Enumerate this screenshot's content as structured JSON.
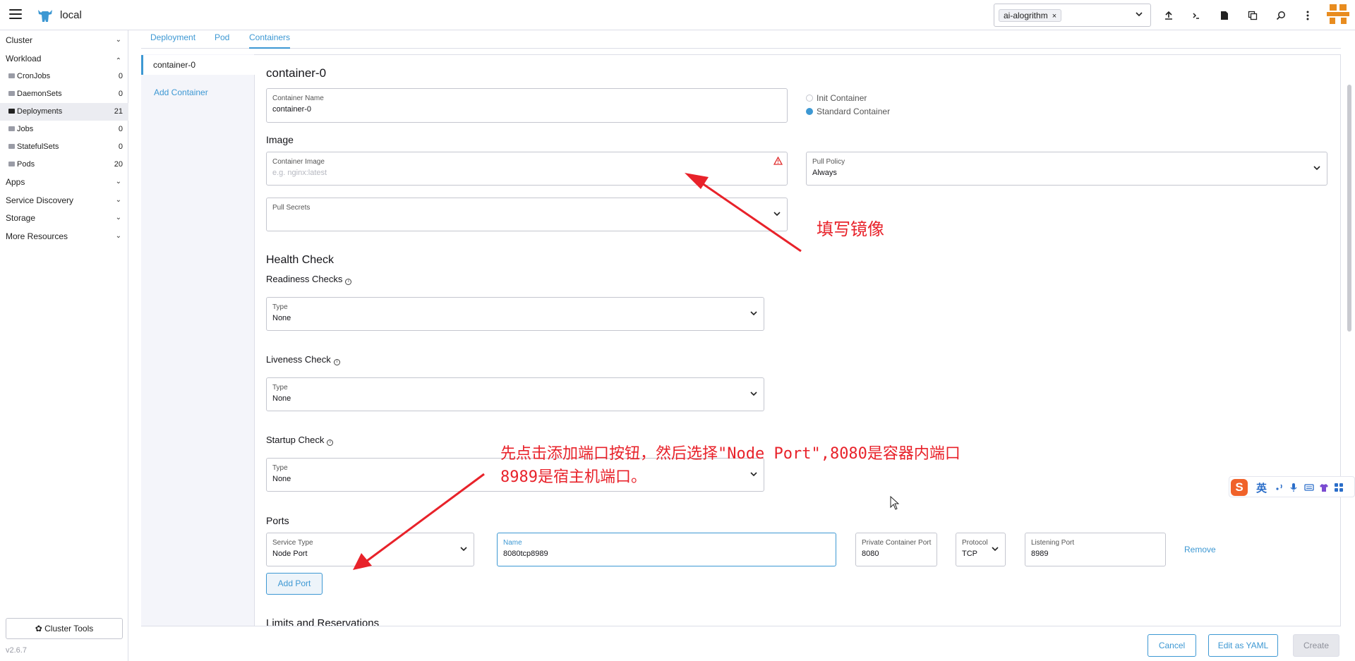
{
  "header": {
    "cluster_name": "local",
    "namespace_chip": "ai-alogrithm",
    "namespace_chip_close": "×"
  },
  "sidebar": {
    "groups": [
      {
        "label": "Cluster",
        "chevron": "⌄"
      },
      {
        "label": "Workload",
        "chevron": "⌃"
      },
      {
        "label": "Apps",
        "chevron": "⌄"
      },
      {
        "label": "Service Discovery",
        "chevron": "⌄"
      },
      {
        "label": "Storage",
        "chevron": "⌄"
      },
      {
        "label": "More Resources",
        "chevron": "⌄"
      }
    ],
    "items": [
      {
        "label": "CronJobs",
        "count": "0"
      },
      {
        "label": "DaemonSets",
        "count": "0"
      },
      {
        "label": "Deployments",
        "count": "21"
      },
      {
        "label": "Jobs",
        "count": "0"
      },
      {
        "label": "StatefulSets",
        "count": "0"
      },
      {
        "label": "Pods",
        "count": "20"
      }
    ],
    "cluster_tools": "✿ Cluster Tools",
    "version": "v2.6.7"
  },
  "tabs": [
    "Deployment",
    "Pod",
    "Containers"
  ],
  "containers": {
    "active_tab": "container-0",
    "add_container": "Add Container"
  },
  "form": {
    "title": "container-0",
    "container_name": {
      "label": "Container Name",
      "value": "container-0"
    },
    "radio_init": "Init Container",
    "radio_standard": "Standard Container",
    "image_section": "Image",
    "container_image": {
      "label": "Container Image",
      "placeholder": "e.g. nginx:latest"
    },
    "pull_policy": {
      "label": "Pull Policy",
      "value": "Always"
    },
    "pull_secrets": {
      "label": "Pull Secrets"
    },
    "health_check": "Health Check",
    "readiness": {
      "title": "Readiness Checks",
      "label": "Type",
      "value": "None"
    },
    "liveness": {
      "title": "Liveness Check",
      "label": "Type",
      "value": "None"
    },
    "startup": {
      "title": "Startup Check",
      "label": "Type",
      "value": "None"
    },
    "ports_section": "Ports",
    "service_type": {
      "label": "Service Type",
      "value": "Node Port"
    },
    "port_name": {
      "label": "Name",
      "value": "8080tcp8989"
    },
    "private_port": {
      "label": "Private Container Port",
      "value": "8080"
    },
    "protocol": {
      "label": "Protocol",
      "value": "TCP"
    },
    "listening_port": {
      "label": "Listening Port",
      "value": "8989"
    },
    "remove": "Remove",
    "add_port": "Add Port",
    "limits_section": "Limits and Reservations"
  },
  "footer": {
    "cancel": "Cancel",
    "edit_yaml": "Edit as YAML",
    "create": "Create"
  },
  "annotations": {
    "image_note": "填写镜像",
    "port_note_line1": "先点击添加端口按钮，然后选择\"Node Port\",8080是容器内端口",
    "port_note_line2": "8989是宿主机端口。"
  },
  "ime": {
    "logo": "S",
    "mode": "英"
  },
  "colors": {
    "accent": "#3d98d3",
    "annotation": "#e8222a",
    "warning": "#e02d2d",
    "brand": "#e88c1f"
  }
}
